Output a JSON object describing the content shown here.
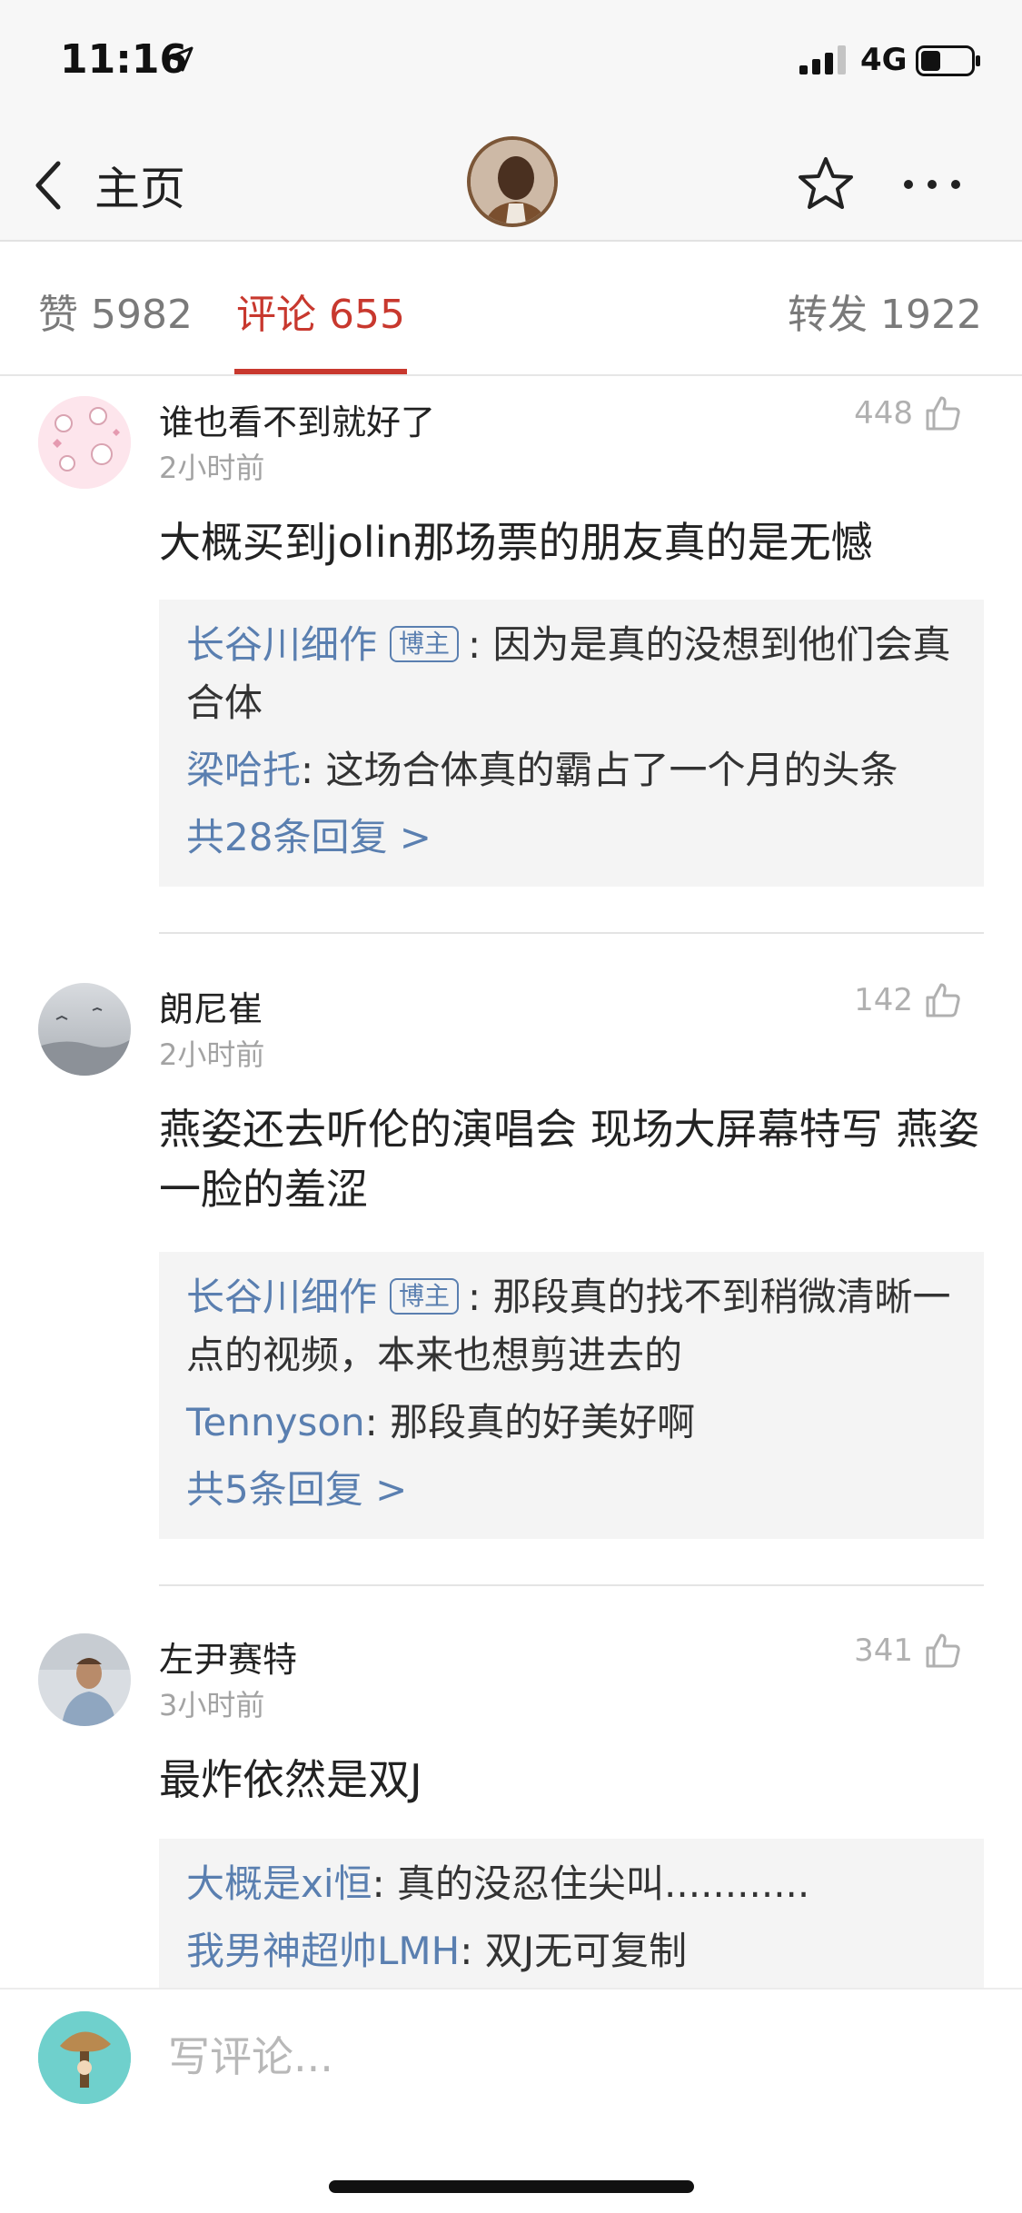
{
  "status": {
    "time": "11:16",
    "network": "4G",
    "battery_level": 0.4
  },
  "nav": {
    "back_label": "主页"
  },
  "tabs": {
    "likes": "赞 5982",
    "comments": "评论 655",
    "reposts": "转发 1922",
    "active": "comments"
  },
  "comments": [
    {
      "author": "谁也看不到就好了",
      "time": "2小时前",
      "likes": "448",
      "text": "大概买到jolin那场票的朋友真的是无憾",
      "replies": [
        {
          "author": "长谷川细作",
          "badge": "博主",
          "text": ": 因为是真的没想到他们会真合体"
        },
        {
          "author": "梁哈托",
          "text": ": 这场合体真的霸占了一个月的头条"
        }
      ],
      "more": "共28条回复 >"
    },
    {
      "author": "朗尼崔",
      "time": "2小时前",
      "likes": "142",
      "text": "燕姿还去听伦的演唱会 现场大屏幕特写 燕姿一脸的羞涩",
      "replies": [
        {
          "author": "长谷川细作",
          "badge": "博主",
          "text": ": 那段真的找不到稍微清晰一点的视频，本来也想剪进去的"
        },
        {
          "author": "Tennyson",
          "text": ": 那段真的好美好啊"
        }
      ],
      "more": "共5条回复 >"
    },
    {
      "author": "左尹赛特",
      "time": "3小时前",
      "likes": "341",
      "text": "最炸依然是双J",
      "replies": [
        {
          "author": "大概是xi恒",
          "text": ": 真的没忍住尖叫............"
        },
        {
          "author": "我男神超帅LMH",
          "text": ": 双J无可复制"
        }
      ]
    }
  ],
  "bottom": {
    "placeholder": "写评论..."
  },
  "colors": {
    "accent": "#c8382e",
    "link": "#5a7fb0",
    "muted": "#a3a3a3"
  }
}
